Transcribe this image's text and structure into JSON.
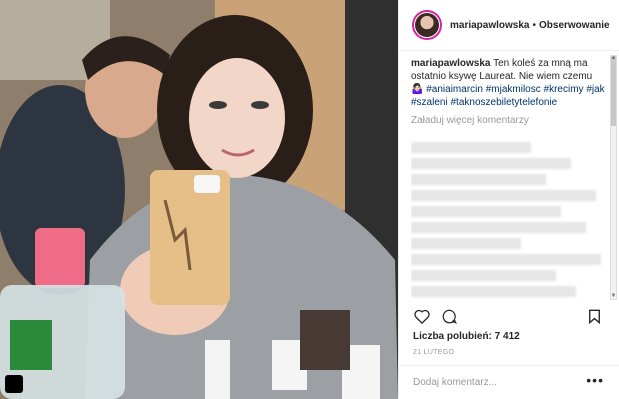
{
  "post": {
    "username": "mariapawlowska",
    "separator": "•",
    "follow_label": "Obserwowanie",
    "caption_user": "mariapawlowska",
    "caption_text": " Ten koleś za mną ma ostatnio ksywę Laureat. Nie wiem czemu 🤷🏻‍♀️",
    "hashtags": [
      "#aniaimarcin",
      "#mjakmilosc",
      "#krecimy",
      "#jak",
      "#szaleni",
      "#taknoszebiletytelefonie"
    ],
    "load_more": "Załaduj więcej komentarzy",
    "likes": "Liczba polubień: 7 412",
    "date": "21 LUTEGO",
    "add_comment_placeholder": "Dodaj komentarz...",
    "more_icon": "•••"
  },
  "colors": {
    "hashtag": "#003569",
    "text": "#262626",
    "muted": "#999999"
  }
}
